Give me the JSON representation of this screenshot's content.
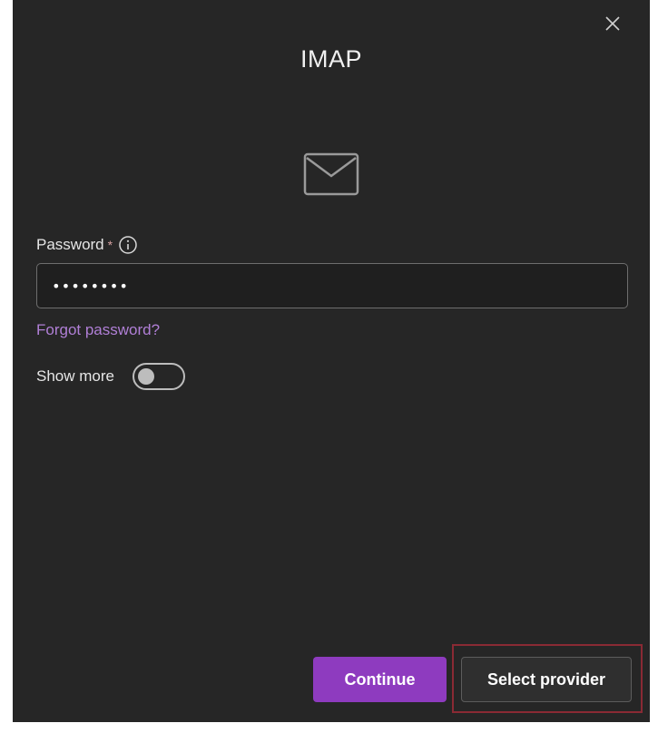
{
  "dialog": {
    "title": "IMAP",
    "close_icon": "close-icon",
    "header_icon": "mail-icon"
  },
  "password": {
    "label": "Password",
    "required_marker": "*",
    "info_icon": "info-icon",
    "value": "••••••••"
  },
  "forgot_password": {
    "label": "Forgot password?"
  },
  "show_more": {
    "label": "Show more",
    "toggle_on": false
  },
  "actions": {
    "continue_label": "Continue",
    "select_provider_label": "Select provider"
  },
  "colors": {
    "dialog_bg": "#262626",
    "accent": "#8e3bbf",
    "link": "#b07fd6",
    "highlight_outline": "#8a2a34"
  }
}
